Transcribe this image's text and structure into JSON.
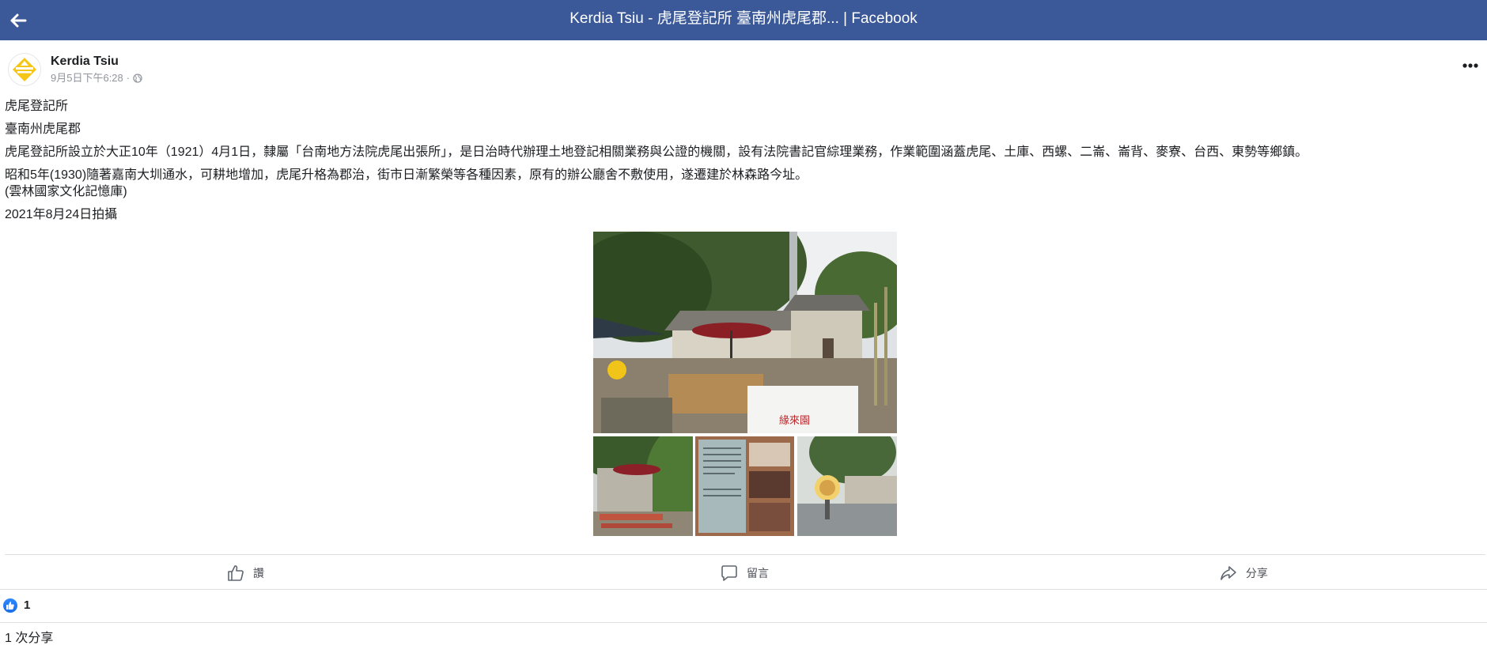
{
  "header": {
    "title": "Kerdia Tsiu - 虎尾登記所 臺南州虎尾郡... | Facebook"
  },
  "post": {
    "author": "Kerdia Tsiu",
    "timestamp": "9月5日下午6:28",
    "separator": "·",
    "privacy_icon": "globe-icon",
    "lines": [
      "虎尾登記所",
      "臺南州虎尾郡",
      "虎尾登記所設立於大正10年（1921）4月1日，隸屬「台南地方法院虎尾出張所」，是日治時代辦理土地登記相關業務與公證的機關，設有法院書記官綜理業務，作業範圍涵蓋虎尾、土庫、西螺、二崙、崙背、麥寮、台西、東勢等鄉鎮。",
      "昭和5年(1930)隨著嘉南大圳通水，可耕地增加，虎尾升格為郡治，街市日漸繁榮等各種因素，原有的辦公廳舍不敷使用，遂遷建於林森路今址。",
      "(雲林國家文化記憶庫)",
      "2021年8月24日拍攝"
    ],
    "photo_sign_text": "緣來園"
  },
  "actions": {
    "like": "讚",
    "comment": "留言",
    "share": "分享"
  },
  "stats": {
    "reaction_count": "1",
    "share_count": "1 次分享"
  },
  "colors": {
    "header_bg": "#3b5998",
    "like_blue": "#1877f2",
    "logo_yellow": "#f5c518"
  }
}
